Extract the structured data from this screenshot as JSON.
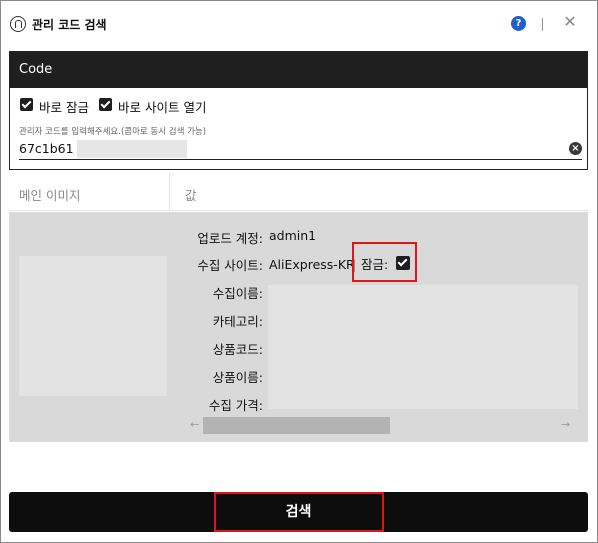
{
  "window": {
    "title": "관리 코드 검색",
    "help_glyph": "?",
    "close_glyph": "✕"
  },
  "code_panel": {
    "header": "Code",
    "options": [
      {
        "label": "바로 잠금",
        "checked": true
      },
      {
        "label": "바로 사이트 열기",
        "checked": true
      }
    ],
    "input_hint": "관리자 코드를 입력해주세요.(콤마로 동시 검색 가능)",
    "input_value": "67c1b61"
  },
  "result": {
    "columns": [
      "메인 이미지",
      "값"
    ],
    "fields": {
      "upload_account_label": "업로드 계정:",
      "upload_account_value": "admin1",
      "site_label": "수집 사이트:",
      "site_value": "AliExpress-KR",
      "site_separator": "|",
      "lock_label": "잠금:",
      "lock_checked": true,
      "name_label": "수집이름:",
      "category_label": "카테고리:",
      "product_code_label": "상품코드:",
      "product_name_label": "상품이름:",
      "price_label": "수집 가격:"
    },
    "scroll_left_glyph": "←",
    "scroll_right_glyph": "→"
  },
  "search_button": {
    "label": "검색"
  },
  "colors": {
    "header_dark": "#1f1f1f",
    "highlight_red": "#e01515",
    "help_blue": "#1e5fc8",
    "row_gray": "#d9d9d9"
  }
}
